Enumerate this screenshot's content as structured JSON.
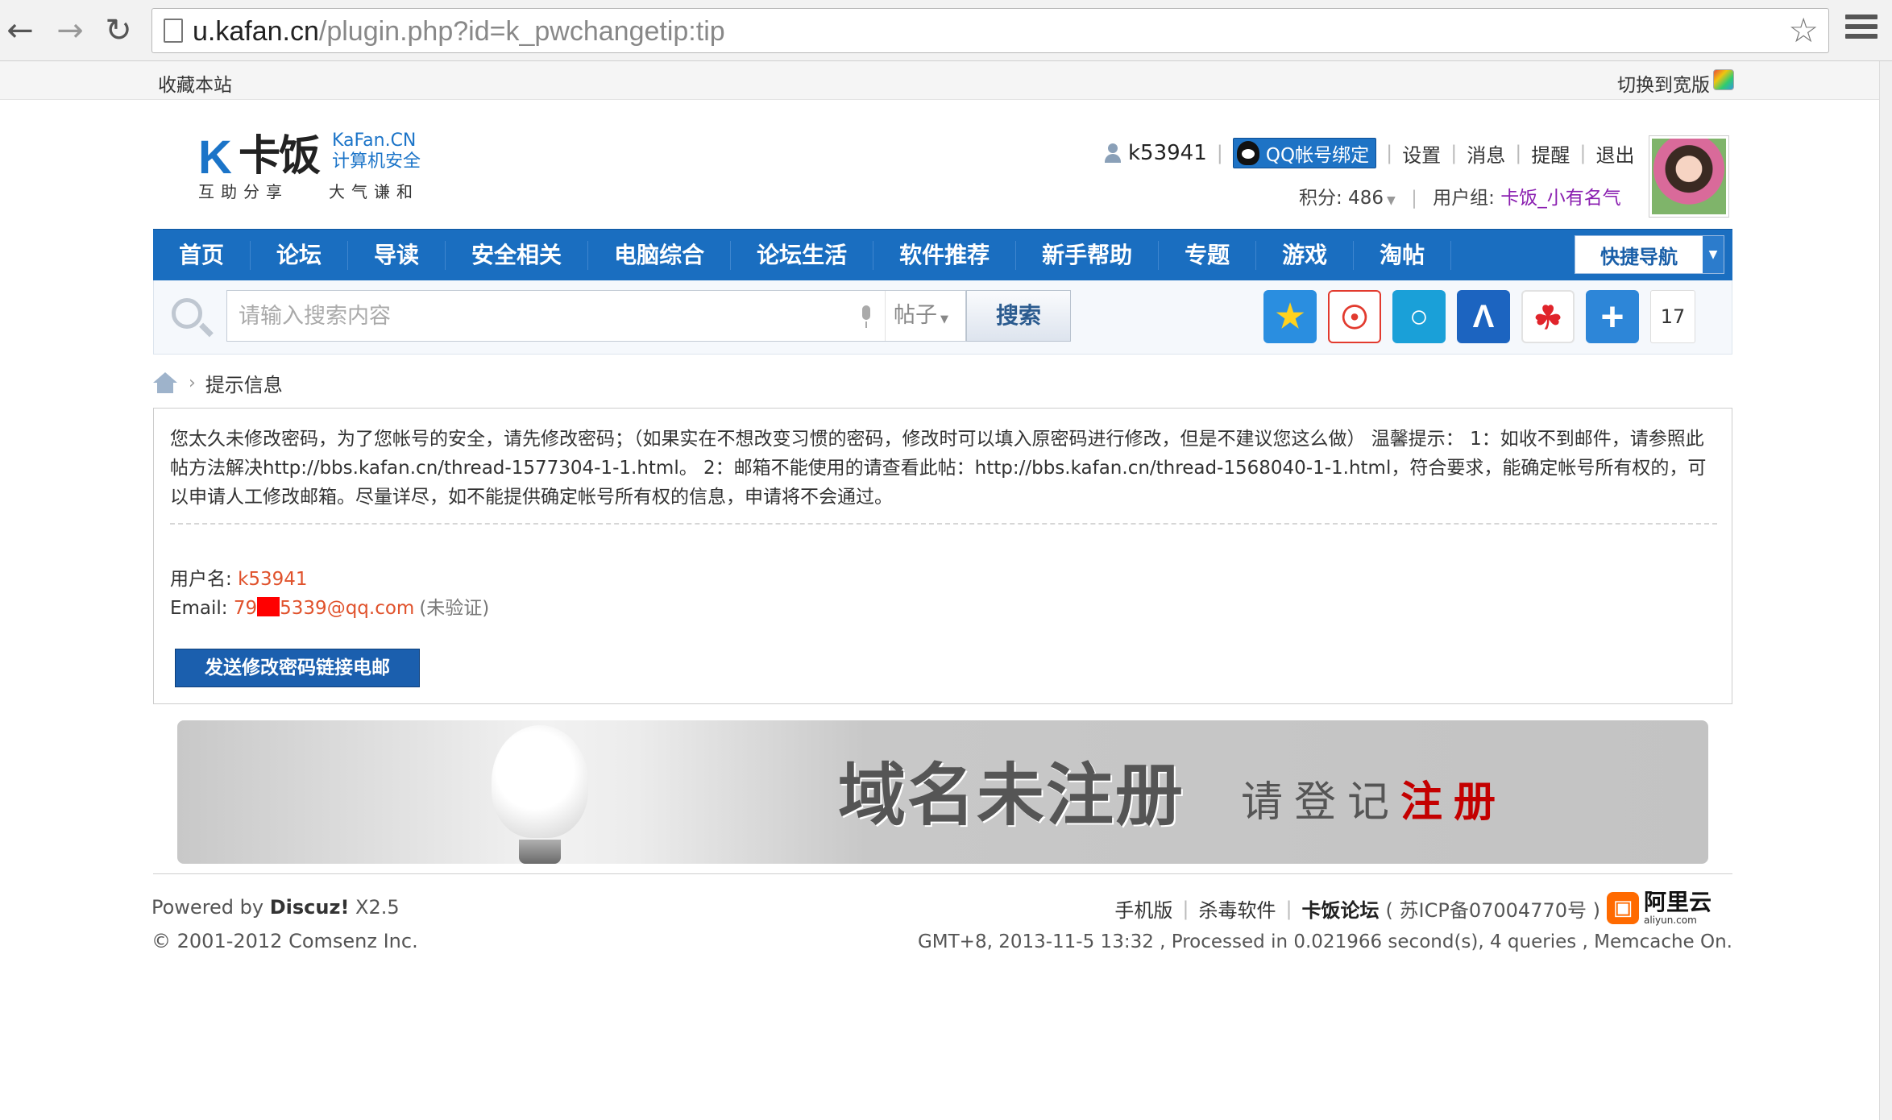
{
  "browser": {
    "url_host": "u.kafan.cn",
    "url_path": "/plugin.php?id=k_pwchangetip:tip",
    "back_icon": "arrow-left-icon",
    "forward_icon": "arrow-right-icon",
    "reload_icon": "reload-icon",
    "star_icon": "star-icon",
    "menu_icon": "hamburger-menu-icon"
  },
  "topbar": {
    "favorite": "收藏本站",
    "switch_wide": "切换到宽版"
  },
  "logo": {
    "mark": "K",
    "name": "卡饭",
    "en_line1": "KaFan.CN",
    "en_line2": "计算机安全",
    "tagline_left": "互助分享",
    "tagline_right": "大气谦和"
  },
  "user": {
    "username": "k53941",
    "qq_bind": "QQ帐号绑定",
    "links": [
      "设置",
      "消息",
      "提醒",
      "退出"
    ],
    "points_label": "积分: 486",
    "group_label": "用户组: ",
    "group_value": "卡饭_小有名气"
  },
  "nav": {
    "items": [
      "首页",
      "论坛",
      "导读",
      "安全相关",
      "电脑综合",
      "论坛生活",
      "软件推荐",
      "新手帮助",
      "专题",
      "游戏",
      "淘帖"
    ],
    "quick_nav": "快捷导航"
  },
  "search": {
    "placeholder": "请输入搜索内容",
    "type": "帖子",
    "button": "搜索",
    "share_count": "17",
    "share_icons": [
      "qzone-icon",
      "weibo-icon",
      "tencent-weibo-icon",
      "renren-icon",
      "kaixin-icon",
      "add-more-icon"
    ]
  },
  "breadcrumb": {
    "current": "提示信息"
  },
  "message": {
    "text": "您太久未修改密码，为了您帐号的安全，请先修改密码；（如果实在不想改变习惯的密码，修改时可以填入原密码进行修改，但是不建议您这么做） 温馨提示： 1：如收不到邮件，请参照此帖方法解决http://bbs.kafan.cn/thread-1577304-1-1.html。 2：邮箱不能使用的请查看此帖：http://bbs.kafan.cn/thread-1568040-1-1.html，符合要求，能确定帐号所有权的，可以申请人工修改邮箱。尽量详尽，如不能提供确定帐号所有权的信息，申请将不会通过。",
    "username_label": "用户名: ",
    "username_value": "k53941",
    "email_label": "Email: ",
    "email_prefix": "79",
    "email_suffix": "5339@qq.com",
    "email_note": "(未验证)",
    "send_button": "发送修改密码链接电邮"
  },
  "banner": {
    "headline": "域名未注册",
    "sub_plain": "请登记",
    "sub_red": "注册"
  },
  "footer": {
    "powered_prefix": "Powered by ",
    "powered_brand": "Discuz!",
    "powered_version": " X2.5",
    "copyright": "© 2001-2012 Comsenz Inc.",
    "links": [
      "手机版",
      "杀毒软件"
    ],
    "site_name": "卡饭论坛",
    "icp": "( 苏ICP备07004770号 )",
    "aliyun_name": "阿里云",
    "aliyun_domain": "aliyun.com",
    "stats": "GMT+8, 2013-11-5 13:32 , Processed in 0.021966 second(s), 4 queries , Memcache On."
  }
}
